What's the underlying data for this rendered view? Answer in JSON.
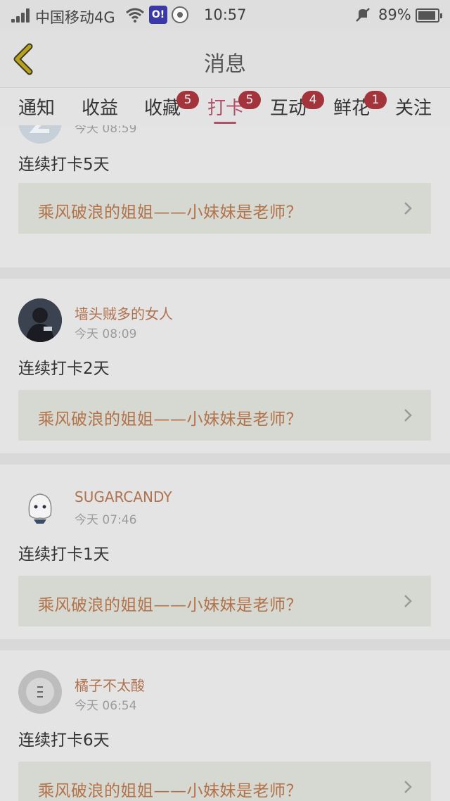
{
  "status_bar": {
    "carrier": "中国移动4G",
    "time": "10:57",
    "battery": "89%",
    "app1_label": "O!"
  },
  "header": {
    "title": "消息"
  },
  "tabs": [
    {
      "label": "通知",
      "badge": ""
    },
    {
      "label": "收益",
      "badge": ""
    },
    {
      "label": "收藏",
      "badge": "5"
    },
    {
      "label": "打卡",
      "badge": "5",
      "active": true
    },
    {
      "label": "互动",
      "badge": "4"
    },
    {
      "label": "鲜花",
      "badge": "1"
    },
    {
      "label": "关注",
      "badge": ""
    }
  ],
  "feed": [
    {
      "username": "",
      "time": "今天 08:59",
      "streak": "连续打卡5天",
      "link": "乘风破浪的姐姐——小妹妹是老师？"
    },
    {
      "username": "墙头贼多的女人",
      "time": "今天 08:09",
      "streak": "连续打卡2天",
      "link": "乘风破浪的姐姐——小妹妹是老师？"
    },
    {
      "username": "SUGARCANDY",
      "time": "今天 07:46",
      "streak": "连续打卡1天",
      "link": "乘风破浪的姐姐——小妹妹是老师？"
    },
    {
      "username": "橘子不太酸",
      "time": "今天 06:54",
      "streak": "连续打卡6天",
      "link": "乘风破浪的姐姐——小妹妹是老师？"
    }
  ],
  "colors": {
    "accent": "#b0506a",
    "badge": "#a3343c",
    "username": "#b0724f",
    "link_text": "#b2724a",
    "back_arrow": "#b8a21a"
  }
}
